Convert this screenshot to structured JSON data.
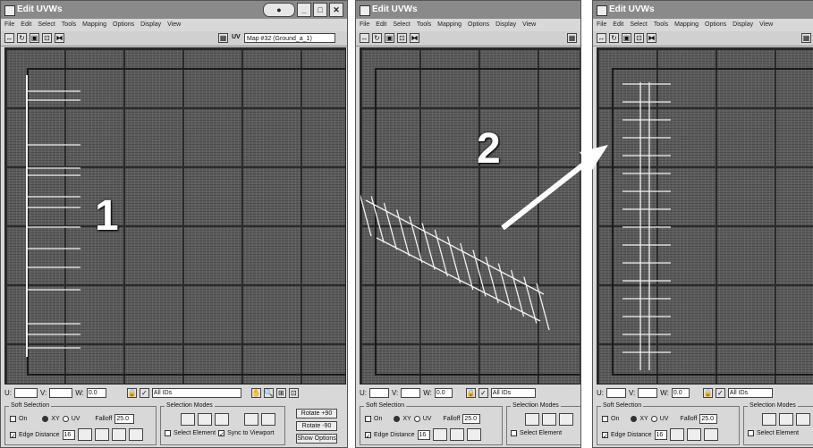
{
  "windows": [
    {
      "title": "Edit UVWs",
      "menu": [
        "File",
        "Edit",
        "Select",
        "Tools",
        "Mapping",
        "Options",
        "Display",
        "View"
      ],
      "map_label": "UV",
      "map_dropdown": "Map #32 (Ground_a_1)",
      "fields": {
        "u": "",
        "v": "",
        "w": "0.0"
      },
      "zoom_dropdown": "All IDs",
      "soft_selection": "Soft Selection",
      "falloff": "Falloff",
      "falloff_value": "25.0",
      "on_label": "On",
      "xy_label": "XY",
      "uv_label": "UV",
      "edge_distance": "Edge Distance",
      "edge_distance_value": "16",
      "selection_modes": "Selection Modes",
      "select_element": "Select Element",
      "sync_viewport": "Sync to Viewport",
      "rotate_plus": "Rotate +90",
      "rotate_minus": "Rotate -90",
      "show_options": "Show Options"
    },
    {
      "title": "Edit UVWs",
      "menu": [
        "File",
        "Edit",
        "Select",
        "Tools",
        "Mapping",
        "Options",
        "Display",
        "View"
      ],
      "fields": {
        "u": "",
        "v": "",
        "w": "0.0"
      },
      "zoom_dropdown": "All IDs",
      "soft_selection": "Soft Selection",
      "falloff": "Falloff",
      "falloff_value": "25.0",
      "on_label": "On",
      "xy_label": "XY",
      "uv_label": "UV",
      "edge_distance": "Edge Distance",
      "edge_distance_value": "16",
      "selection_modes": "Selection Modes",
      "select_element": "Select Element"
    },
    {
      "title": "Edit UVWs",
      "menu": [
        "File",
        "Edit",
        "Select",
        "Tools",
        "Mapping",
        "Options",
        "Display",
        "View"
      ],
      "fields": {
        "u": "",
        "v": "",
        "w": "0.0"
      },
      "zoom_dropdown": "All IDs",
      "soft_selection": "Soft Selection",
      "falloff": "Falloff",
      "falloff_value": "25.0",
      "on_label": "On",
      "xy_label": "XY",
      "uv_label": "UV",
      "edge_distance": "Edge Distance",
      "edge_distance_value": "16",
      "selection_modes": "Selection Modes",
      "select_element": "Select Element"
    }
  ],
  "step_labels": [
    "1",
    "2"
  ],
  "colors": {
    "uv_lines": "#f2f2f2",
    "grid_dark": "#2a2a2a",
    "arrow": "#ffffff"
  }
}
